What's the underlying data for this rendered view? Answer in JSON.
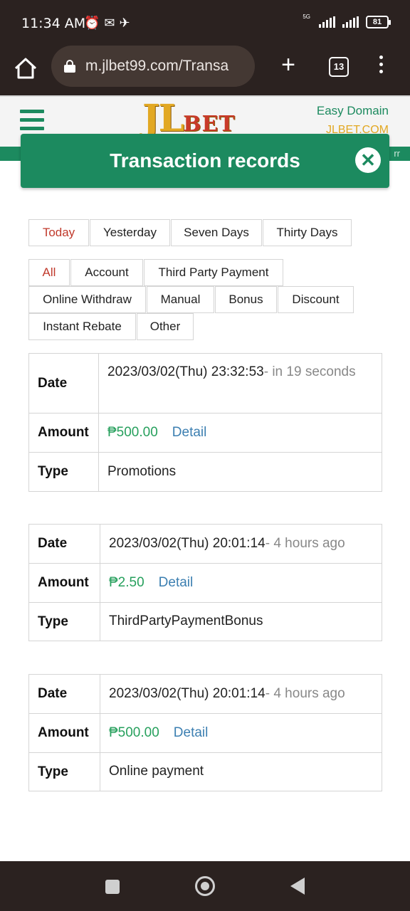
{
  "status_bar": {
    "time": "11:34 AM",
    "network_label": "5G",
    "battery": "81"
  },
  "browser": {
    "url": "m.jlbet99.com/Transa",
    "tab_count": "13"
  },
  "site": {
    "logo_main": "JL",
    "logo_sub": "BET",
    "easy_domain_label": "Easy Domain",
    "easy_domain_url": "JLBET.COM",
    "strip_text": "rr",
    "brand_color": "#1c8a5f"
  },
  "modal": {
    "title": "Transaction records",
    "close_icon": "close-icon"
  },
  "period_tabs": [
    "Today",
    "Yesterday",
    "Seven Days",
    "Thirty Days"
  ],
  "period_active": "Today",
  "type_tabs": [
    "All",
    "Account",
    "Third Party Payment",
    "Online Withdraw",
    "Manual",
    "Bonus",
    "Discount",
    "Instant Rebate",
    "Other"
  ],
  "type_active": "All",
  "labels": {
    "date": "Date",
    "amount": "Amount",
    "type": "Type",
    "detail": "Detail"
  },
  "records": [
    {
      "date": "2023/03/02(Thu) 23:32:53",
      "relative": "- in 19 seconds",
      "amount": "₱500.00",
      "type": "Promotions"
    },
    {
      "date": "2023/03/02(Thu) 20:01:14",
      "relative": "- 4 hours ago",
      "amount": "₱2.50",
      "type": "ThirdPartyPaymentBonus"
    },
    {
      "date": "2023/03/02(Thu) 20:01:14",
      "relative": "- 4 hours ago",
      "amount": "₱500.00",
      "type": "Online payment"
    }
  ]
}
